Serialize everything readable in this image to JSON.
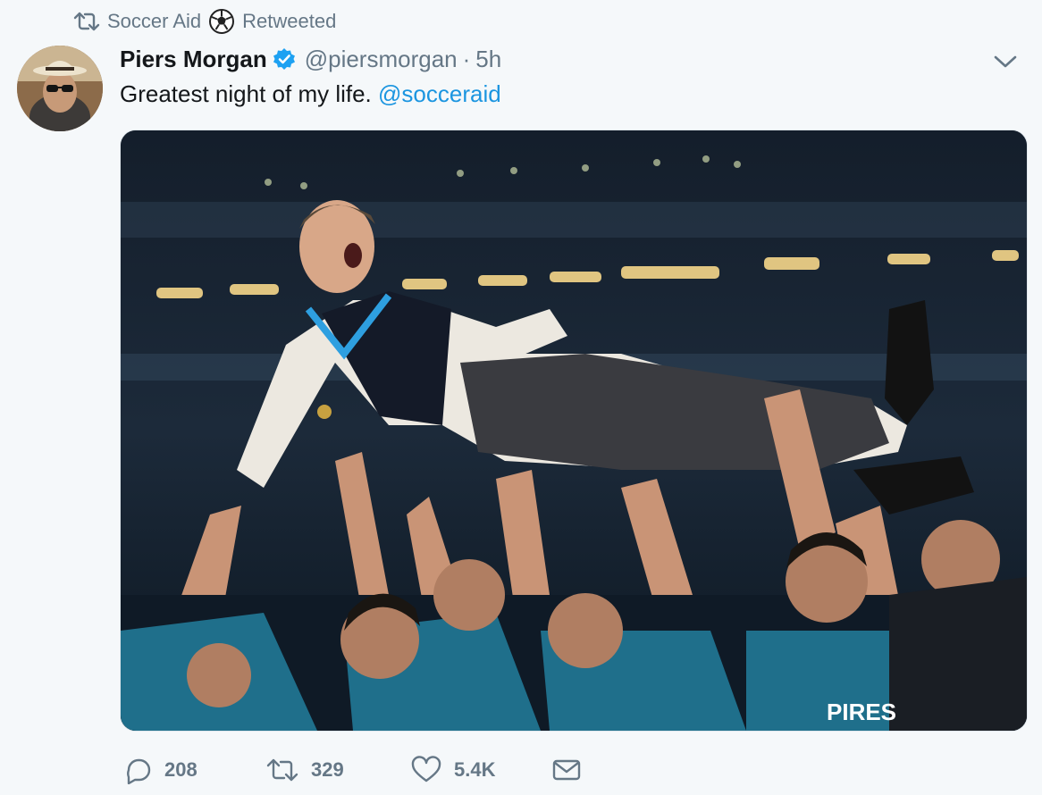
{
  "retweet": {
    "account": "Soccer Aid",
    "status": "Retweeted",
    "icon": "retweet-icon",
    "badge_icon": "soccer-ball-icon"
  },
  "tweet": {
    "author_name": "Piers Morgan",
    "verified": true,
    "handle": "@piersmorgan",
    "separator": "·",
    "time": "5h",
    "text": "Greatest night of my life.",
    "mention": "@socceraid",
    "media_caption": "PIRES"
  },
  "actions": {
    "reply_count": "208",
    "retweet_count": "329",
    "like_count": "5.4K",
    "icons": [
      "reply-icon",
      "retweet-icon",
      "heart-icon",
      "direct-message-icon"
    ]
  },
  "colors": {
    "background": "#f5f8fa",
    "link": "#1b95e0",
    "muted": "#657786",
    "verified": "#1da1f2",
    "text": "#14171a"
  }
}
